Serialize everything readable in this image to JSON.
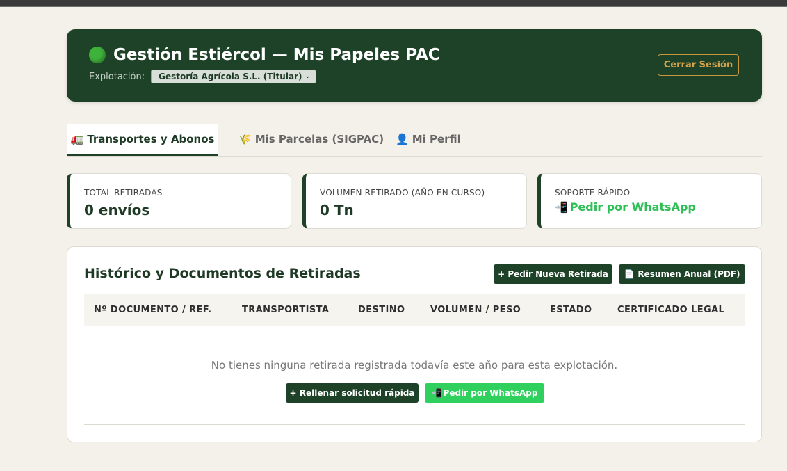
{
  "header": {
    "title": "Gestión Estiércol — Mis Papeles PAC",
    "status_icon": "green-circle-icon",
    "explotacion_label": "Explotación:",
    "explotacion_selected": "Gestoría Agrícola S.L. (Titular)",
    "logout_label": "Cerrar Sesión"
  },
  "tabs": [
    {
      "icon": "🚛",
      "icon_name": "truck-icon",
      "label": "Transportes y Abonos",
      "active": true
    },
    {
      "icon": "🌾",
      "icon_name": "wheat-icon",
      "label": "Mis Parcelas (SIGPAC)",
      "active": false
    },
    {
      "icon": "👤",
      "icon_name": "user-icon",
      "label": "Mi Perfil",
      "active": false
    }
  ],
  "stats": [
    {
      "label": "TOTAL RETIRADAS",
      "value": "0 envíos"
    },
    {
      "label": "VOLUMEN RETIRADO (AÑO EN CURSO)",
      "value": "0 Tn"
    },
    {
      "label": "SOPORTE RÁPIDO",
      "link": "Pedir por WhatsApp",
      "icon": "📲"
    }
  ],
  "panel": {
    "title": "Histórico y Documentos de Retiradas",
    "new_button": "+ Pedir Nueva Retirada",
    "pdf_button": "Resumen Anual (PDF)",
    "pdf_icon": "📄",
    "columns": [
      "Nº DOCUMENTO / REF.",
      "TRANSPORTISTA",
      "DESTINO",
      "VOLUMEN / PESO",
      "ESTADO",
      "CERTIFICADO LEGAL"
    ],
    "empty_message": "No tienes ninguna retirada registrada todavía este año para esta explotación.",
    "quick_button": "+ Rellenar solicitud rápida",
    "whatsapp_button": "Pedir por WhatsApp",
    "whatsapp_icon": "📲"
  },
  "colors": {
    "brand_dark": "#1e4228",
    "whatsapp": "#2fd05e",
    "accent_gold": "#c9973f",
    "background": "#f4f1ea"
  }
}
